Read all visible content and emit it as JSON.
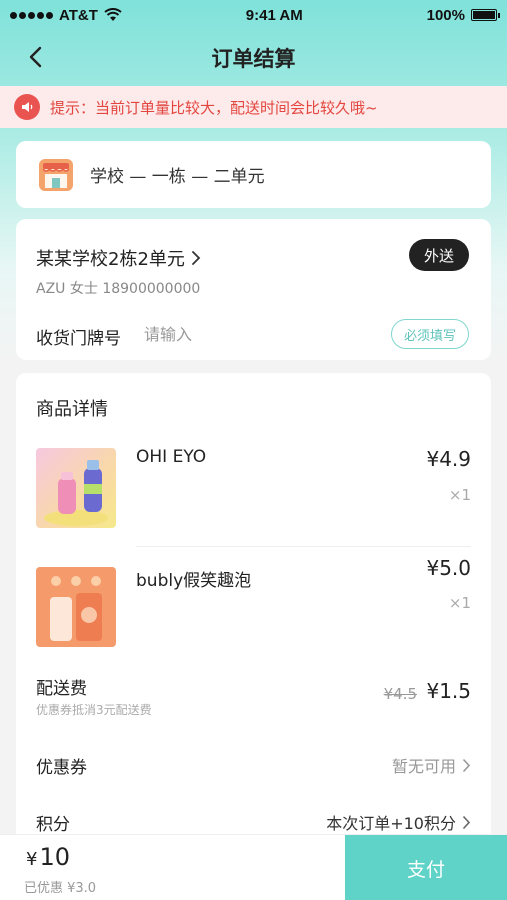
{
  "status_bar": {
    "carrier": "AT&T",
    "time": "9:41 AM",
    "battery": "100%"
  },
  "nav": {
    "title": "订单结算"
  },
  "notice": {
    "text": "提示：当前订单量比较大，配送时间会比较久哦~"
  },
  "address_short": {
    "text": "学校 — 一栋 — 二单元"
  },
  "address": {
    "name": "某某学校2栋2单元",
    "contact": "AZU 女士   18900000000",
    "delivery_mode": "外送",
    "door_label": "收货门牌号",
    "door_placeholder": "请输入",
    "door_value": "",
    "required_label": "必须填写"
  },
  "goods": {
    "title": "商品详情",
    "items": [
      {
        "name": "OHI EYO",
        "price": "¥4.9",
        "qty": "×1"
      },
      {
        "name": "bubly假笑趣泡",
        "price": "¥5.0",
        "qty": "×1"
      }
    ],
    "delivery_fee_label": "配送费",
    "delivery_fee_note": "优惠券抵消3元配送费",
    "delivery_fee_old": "¥4.5",
    "delivery_fee_new": "¥1.5",
    "coupon_label": "优惠券",
    "coupon_value": "暂无可用",
    "points_label": "积分",
    "points_value": "本次订单+10积分"
  },
  "bottom": {
    "currency": "¥",
    "total": "10",
    "discount": "已优惠 ¥3.0",
    "pay_label": "支付"
  },
  "colors": {
    "accent": "#5fd3c8",
    "warning": "#e2463f",
    "notice_bg": "#fdeaea"
  }
}
